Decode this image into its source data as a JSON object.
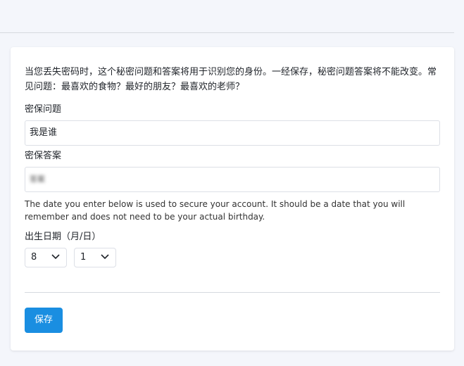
{
  "notice": "当您丢失密码时，这个秘密问题和答案将用于识别您的身份。一经保存，秘密问题答案将不能改变。常见问题：最喜欢的食物？最好的朋友？最喜欢的老师？",
  "question": {
    "label": "密保问题",
    "value": "我是谁"
  },
  "answer": {
    "label": "密保答案",
    "value": "答案"
  },
  "helper": "The date you enter below is used to secure your account. It should be a date that you will remember and does not need to be your actual birthday.",
  "birthday": {
    "label": "出生日期（月/日）",
    "month": "8",
    "day": "1"
  },
  "save_label": "保存",
  "colors": {
    "accent": "#1a8ee1",
    "page_bg": "#f4f6fb",
    "card_bg": "#ffffff"
  }
}
